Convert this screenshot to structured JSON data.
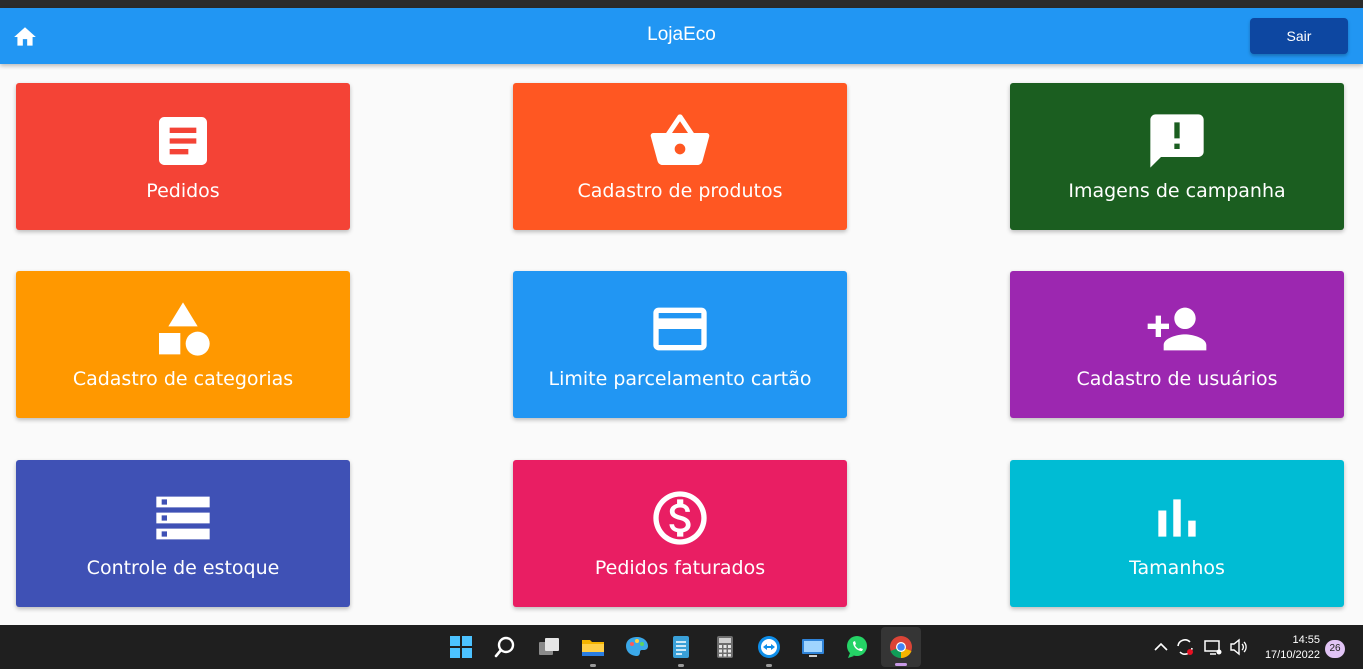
{
  "appbar": {
    "title": "LojaEco",
    "logout_label": "Sair",
    "home_icon": "home-icon",
    "color": "#2196f3"
  },
  "cards": [
    {
      "label": "Pedidos",
      "icon": "receipt-icon",
      "color": "#f44336"
    },
    {
      "label": "Cadastro de produtos",
      "icon": "basket-icon",
      "color": "#ff5722"
    },
    {
      "label": "Imagens de campanha",
      "icon": "announcement-icon",
      "color": "#1b5e20"
    },
    {
      "label": "Cadastro de categorias",
      "icon": "category-icon",
      "color": "#ff9800"
    },
    {
      "label": "Limite parcelamento cartão",
      "icon": "credit-card-icon",
      "color": "#2196f3"
    },
    {
      "label": "Cadastro de usuários",
      "icon": "person-add-icon",
      "color": "#9c27b0"
    },
    {
      "label": "Controle de estoque",
      "icon": "storage-icon",
      "color": "#3f51b5"
    },
    {
      "label": "Pedidos faturados",
      "icon": "dollar-circle-icon",
      "color": "#e91e63"
    },
    {
      "label": "Tamanhos",
      "icon": "bar-chart-icon",
      "color": "#00bcd4"
    }
  ],
  "taskbar": {
    "apps": [
      "windows-start-icon",
      "search-icon",
      "task-view-icon",
      "file-explorer-icon",
      "paint-icon",
      "notepad-icon",
      "calculator-icon",
      "teamviewer-icon",
      "remote-desktop-icon",
      "whatsapp-icon",
      "chrome-icon"
    ],
    "time": "14:55",
    "date": "17/10/2022",
    "notification_count": "26"
  }
}
